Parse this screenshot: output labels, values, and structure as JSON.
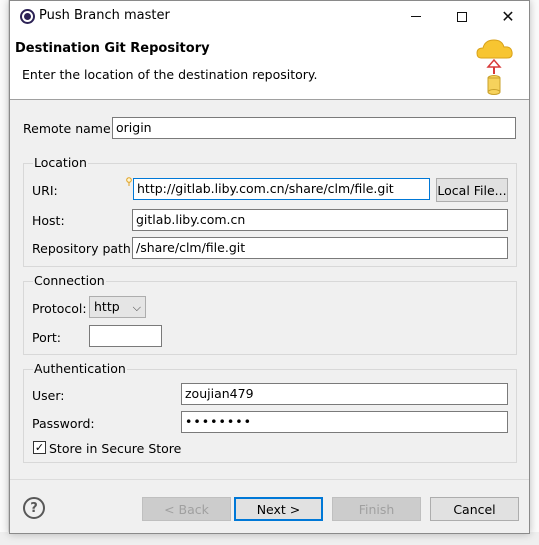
{
  "window": {
    "title": "Push Branch master"
  },
  "header": {
    "title": "Destination Git Repository",
    "description": "Enter the location of the destination repository."
  },
  "remote": {
    "label": "Remote name:",
    "value": "origin"
  },
  "location": {
    "group_title": "Location",
    "uri_label": "URI:",
    "uri_value": "http://gitlab.liby.com.cn/share/clm/file.git",
    "local_file_label": "Local File...",
    "host_label": "Host:",
    "host_value": "gitlab.liby.com.cn",
    "path_label": "Repository path:",
    "path_value": "/share/clm/file.git"
  },
  "connection": {
    "group_title": "Connection",
    "protocol_label": "Protocol:",
    "protocol_value": "http",
    "port_label": "Port:",
    "port_value": ""
  },
  "authentication": {
    "group_title": "Authentication",
    "user_label": "User:",
    "user_value": "zoujian479",
    "password_label": "Password:",
    "password_value": "••••••••",
    "store_label": "Store in Secure Store",
    "store_checked": true
  },
  "buttons": {
    "back": "< Back",
    "next": "Next >",
    "finish": "Finish",
    "cancel": "Cancel"
  },
  "icons": {
    "app": "eclipse-icon",
    "help": "help-icon",
    "wizard": "cloud-push-icon"
  },
  "colors": {
    "focus_border": "#0078d7",
    "dialog_bg": "#f0f0f0"
  }
}
